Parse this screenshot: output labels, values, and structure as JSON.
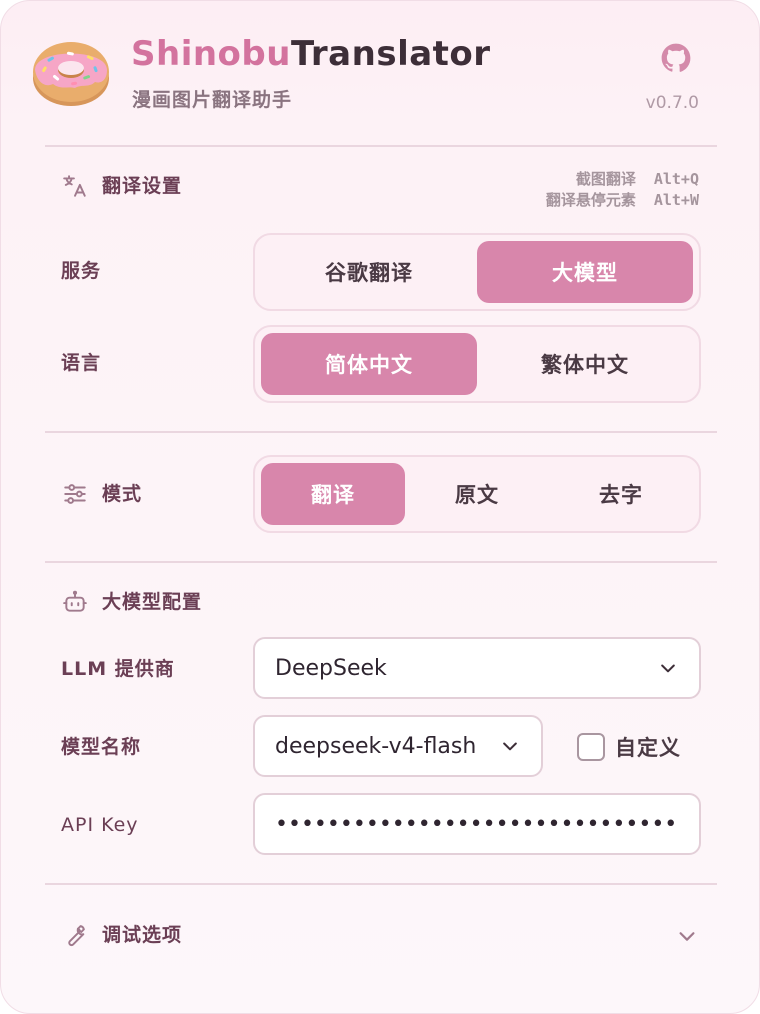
{
  "app": {
    "title_part1": "Shinobu",
    "title_part2": "Translator",
    "subtitle": "漫画图片翻译助手",
    "version": "v0.7.0"
  },
  "translate_settings": {
    "title": "翻译设置",
    "shortcuts": [
      {
        "label": "截图翻译",
        "key": "Alt+Q"
      },
      {
        "label": "翻译悬停元素",
        "key": "Alt+W"
      }
    ],
    "service": {
      "label": "服务",
      "options": [
        "谷歌翻译",
        "大模型"
      ],
      "selected": "大模型"
    },
    "language": {
      "label": "语言",
      "options": [
        "简体中文",
        "繁体中文"
      ],
      "selected": "简体中文"
    }
  },
  "mode": {
    "title": "模式",
    "options": [
      "翻译",
      "原文",
      "去字"
    ],
    "selected": "翻译"
  },
  "llm_config": {
    "title": "大模型配置",
    "provider": {
      "label": "LLM 提供商",
      "value": "DeepSeek"
    },
    "model": {
      "label": "模型名称",
      "value": "deepseek-v4-flash"
    },
    "custom_checkbox": {
      "label": "自定义",
      "checked": false
    },
    "api_key": {
      "label": "API Key",
      "value": "•••••••••••••••••••••••••••••••••••"
    }
  },
  "debug": {
    "title": "调试选项",
    "expanded": false
  },
  "colors": {
    "accent": "#d886ab",
    "brand_pink": "#d3739e",
    "label": "#6b3f55"
  },
  "icons": {
    "logo": "donut-logo",
    "github": "github-icon",
    "translate": "translate-icon",
    "mode": "sliders-icon",
    "llm": "robot-icon",
    "debug": "wrench-icon"
  }
}
